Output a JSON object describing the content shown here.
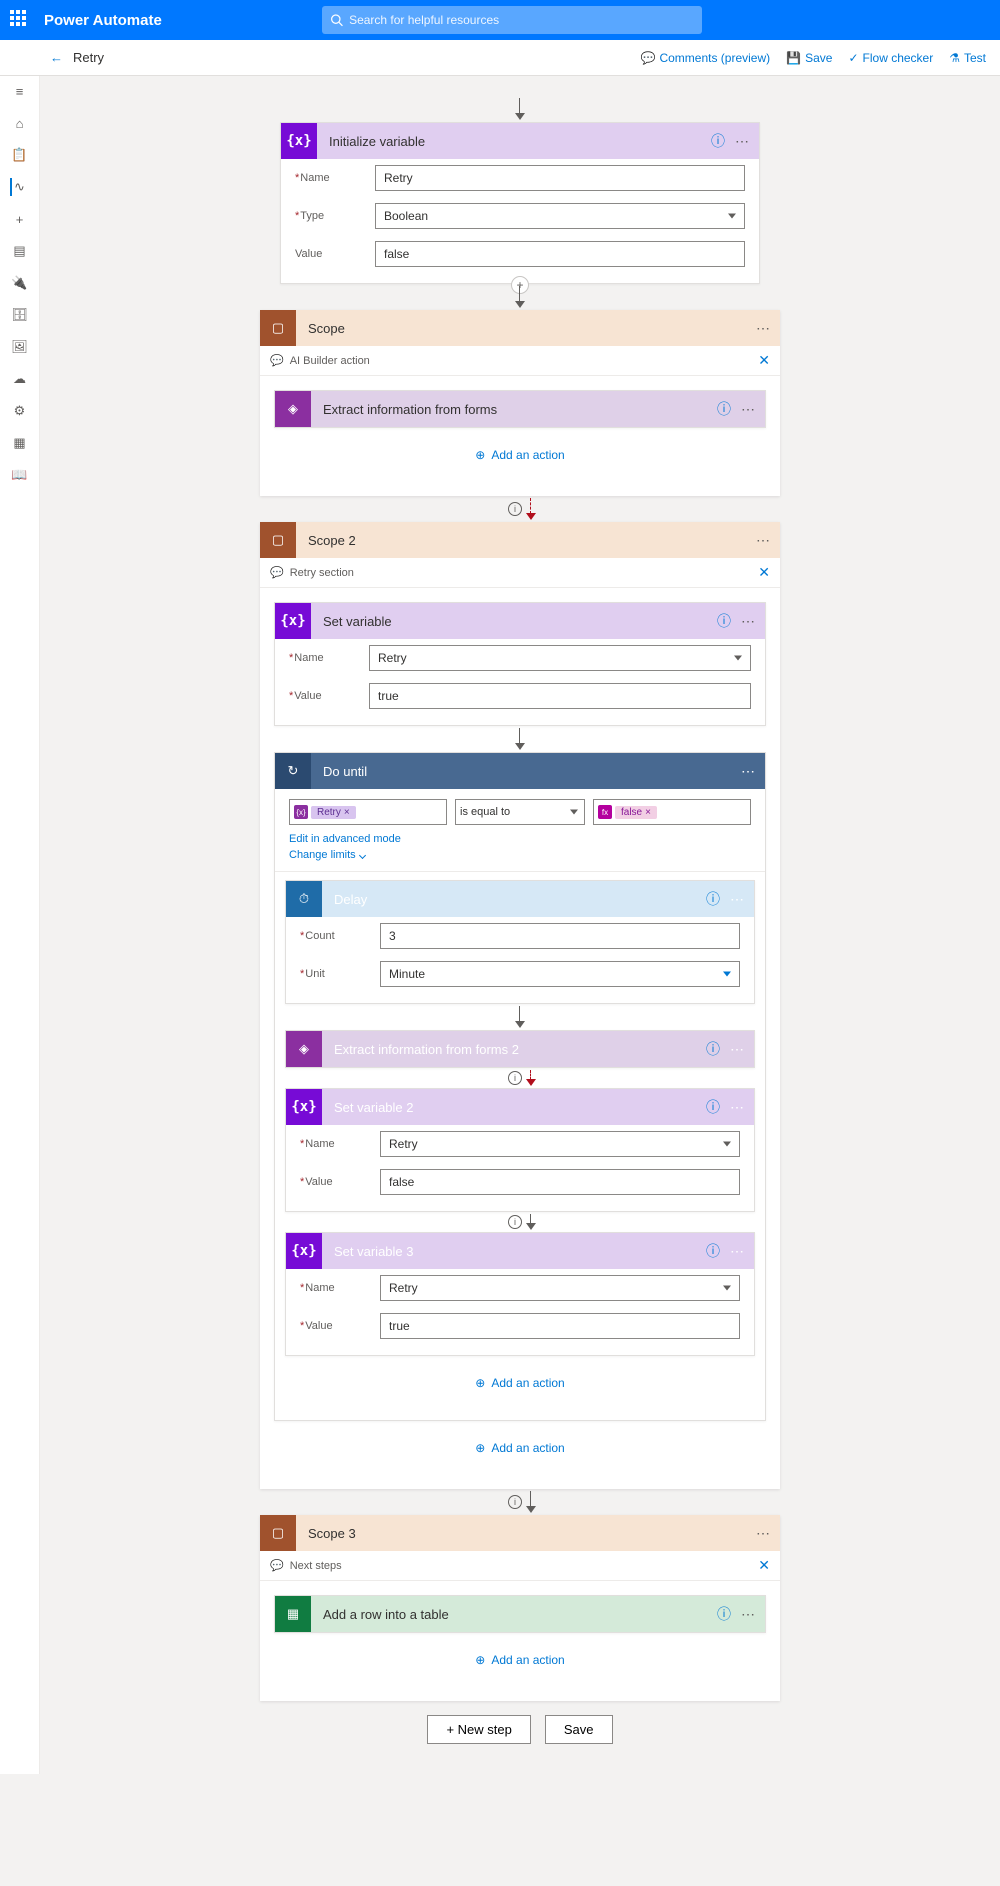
{
  "app": {
    "name": "Power Automate"
  },
  "search": {
    "placeholder": "Search for helpful resources"
  },
  "cmdbar": {
    "title": "Retry",
    "comments": "Comments (preview)",
    "save": "Save",
    "flowchecker": "Flow checker",
    "test": "Test"
  },
  "initvar": {
    "title": "Initialize variable",
    "name_label": "Name",
    "name_value": "Retry",
    "type_label": "Type",
    "type_value": "Boolean",
    "value_label": "Value",
    "value_value": "false"
  },
  "scope1": {
    "title": "Scope",
    "comment": "AI Builder action",
    "extract": "Extract information from forms",
    "add": "Add an action"
  },
  "scope2": {
    "title": "Scope 2",
    "comment": "Retry section",
    "setvar": {
      "title": "Set variable",
      "name_label": "Name",
      "name_value": "Retry",
      "value_label": "Value",
      "value_value": "true"
    },
    "dountil": {
      "title": "Do until",
      "token_retry": "Retry",
      "op": "is equal to",
      "token_false": "false",
      "edit": "Edit in advanced mode",
      "limits": "Change limits"
    },
    "delay": {
      "title": "Delay",
      "count_label": "Count",
      "count_value": "3",
      "unit_label": "Unit",
      "unit_value": "Minute"
    },
    "extract2": "Extract information from forms 2",
    "setvar2": {
      "title": "Set variable 2",
      "name_label": "Name",
      "name_value": "Retry",
      "value_label": "Value",
      "value_value": "false"
    },
    "setvar3": {
      "title": "Set variable 3",
      "name_label": "Name",
      "name_value": "Retry",
      "value_label": "Value",
      "value_value": "true"
    },
    "add": "Add an action"
  },
  "scope3": {
    "title": "Scope 3",
    "comment": "Next steps",
    "addrow": "Add a row into a table",
    "add": "Add an action"
  },
  "footer": {
    "newstep": "+ New step",
    "save": "Save"
  }
}
